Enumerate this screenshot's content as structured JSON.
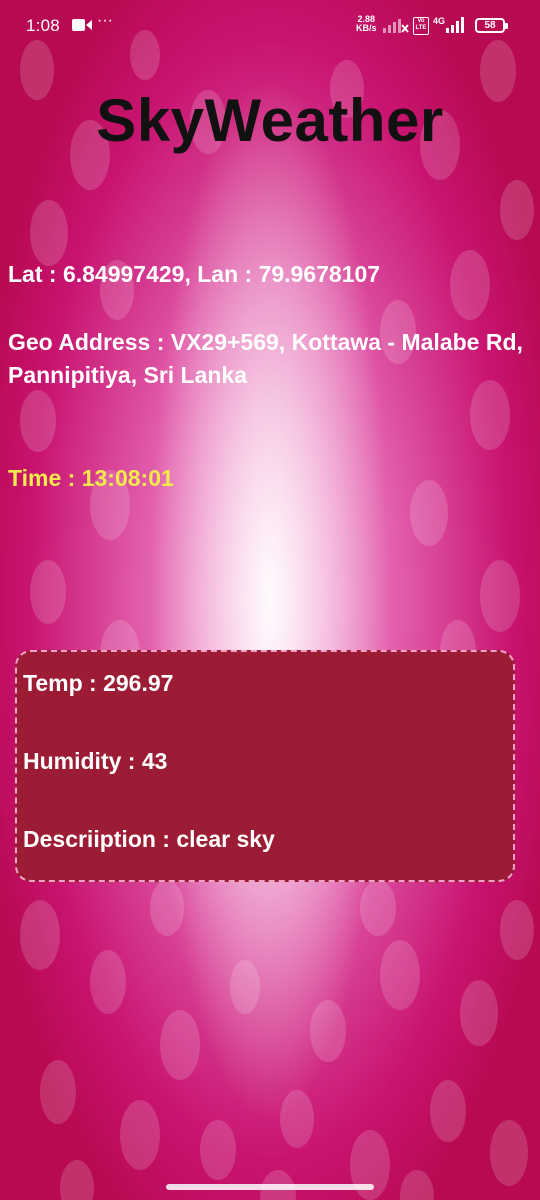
{
  "status_bar": {
    "time": "1:08",
    "speed_value": "2.88",
    "speed_unit": "KB/s",
    "volte_top": "Vo",
    "volte_bottom": "LTE",
    "network_type": "4G",
    "battery_level": "58"
  },
  "app": {
    "title": "SkyWeather",
    "lat_lon": "Lat : 6.84997429, Lan : 79.9678107",
    "geo_address": "Geo Address : VX29+569, Kottawa - Malabe Rd, Pannipitiya, Sri Lanka",
    "time": "Time : 13:08:01"
  },
  "weather": {
    "temp": "Temp : 296.97",
    "humidity": "Humidity : 43",
    "description": "Descriiption : clear sky"
  },
  "colors": {
    "title": "#111111",
    "time_text": "#f4e94c",
    "card_background": "#9b1c34",
    "card_border": "#f3a2c7"
  }
}
